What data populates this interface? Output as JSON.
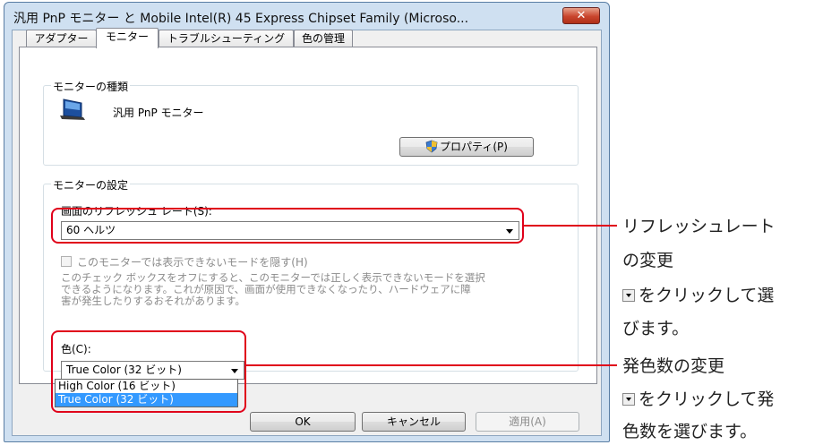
{
  "window": {
    "title": "汎用 PnP モニター と Mobile Intel(R) 45 Express Chipset Family (Microso...",
    "close_label": "✕"
  },
  "tabs": [
    {
      "label": "アダプター"
    },
    {
      "label": "モニター"
    },
    {
      "label": "トラブルシューティング"
    },
    {
      "label": "色の管理"
    }
  ],
  "monitor_type": {
    "legend": "モニターの種類",
    "name": "汎用 PnP モニター",
    "properties_label": "プロパティ(P)"
  },
  "monitor_settings": {
    "legend": "モニターの設定",
    "refresh_label": "画面のリフレッシュ レート(S):",
    "refresh_value": "60 ヘルツ",
    "hide_modes_label": "このモニターでは表示できないモードを隠す(H)",
    "description_line1": "このチェック ボックスをオフにすると、このモニターでは正しく表示できないモードを選択",
    "description_line2": "できるようになります。これが原因で、画面が使用できなくなったり、ハードウェアに障",
    "description_line3": "害が発生したりするおそれがあります。",
    "color_label": "色(C):",
    "color_value": "True Color (32 ビット)",
    "color_options": [
      "High Color (16 ビット)",
      "True Color (32 ビット)"
    ]
  },
  "footer": {
    "ok_label": "OK",
    "cancel_label": "キャンセル",
    "apply_label": "適用(A)"
  },
  "annotations": {
    "refresh": {
      "line1": "リフレッシュレート",
      "line2": "の変更",
      "line3": "をクリックして選",
      "line4": "びます。"
    },
    "color": {
      "line1": "発色数の変更",
      "line2": "をクリックして発",
      "line3": "色数を選びます。"
    },
    "accent_color": "#e0001a"
  }
}
